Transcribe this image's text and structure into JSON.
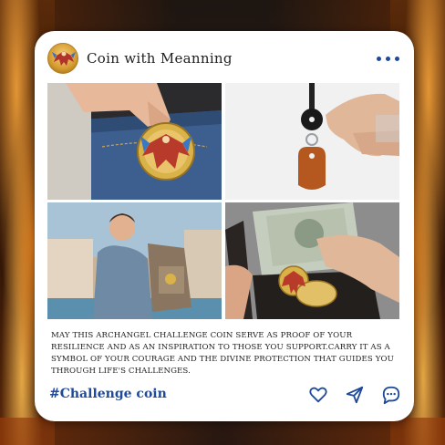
{
  "post": {
    "title": "Coin with Meanning",
    "caption": "MAY THIS ARCHANGEL CHALLENGE COIN SERVE AS PROOF OF YOUR RESILIENCE AND AS AN INSPIRATION TO THOSE YOU SUPPORT.CARRY IT AS A SYMBOL OF YOUR COURAGE AND THE DIVINE PROTECTION THAT GUIDES YOU THROUGH LIFE'S CHALLENGES.",
    "hashtag": "#Challenge coin"
  },
  "icons": {
    "avatar": "archangel-coin-avatar",
    "more": "more-dots-icon",
    "like": "heart-icon",
    "share": "send-icon",
    "comment": "comment-icon"
  },
  "colors": {
    "accent": "#1f4a9a",
    "card": "#ffffff",
    "text": "#222222"
  }
}
